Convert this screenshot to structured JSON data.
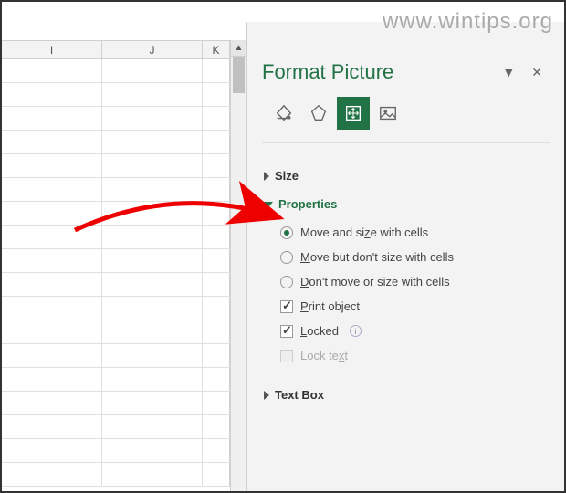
{
  "watermark": "www.wintips.org",
  "spreadsheet": {
    "columns": [
      "I",
      "J",
      "K"
    ]
  },
  "panel": {
    "title": "Format Picture",
    "dropdown_symbol": "▼",
    "close_symbol": "✕",
    "tabs": {
      "fill": "fill-line",
      "effects": "effects",
      "size": "size-properties",
      "picture": "picture"
    },
    "sections": {
      "size": {
        "label": "Size",
        "expanded": false
      },
      "properties": {
        "label": "Properties",
        "expanded": true,
        "radios": [
          {
            "label_pre": "Move and si",
            "key": "z",
            "label_post": "e with cells",
            "checked": true
          },
          {
            "label_pre": "",
            "key": "M",
            "label_post": "ove but don't size with cells",
            "checked": false
          },
          {
            "label_pre": "",
            "key": "D",
            "label_post": "on't move or size with cells",
            "checked": false
          }
        ],
        "checkboxes": [
          {
            "label_pre": "",
            "key": "P",
            "label_post": "rint object",
            "checked": true,
            "disabled": false,
            "info": false
          },
          {
            "label_pre": "",
            "key": "L",
            "label_post": "ocked",
            "checked": true,
            "disabled": false,
            "info": true
          },
          {
            "label_pre": "Lock te",
            "key": "x",
            "label_post": "t",
            "checked": false,
            "disabled": true,
            "info": false
          }
        ]
      },
      "textbox": {
        "label": "Text Box",
        "expanded": false
      }
    }
  }
}
